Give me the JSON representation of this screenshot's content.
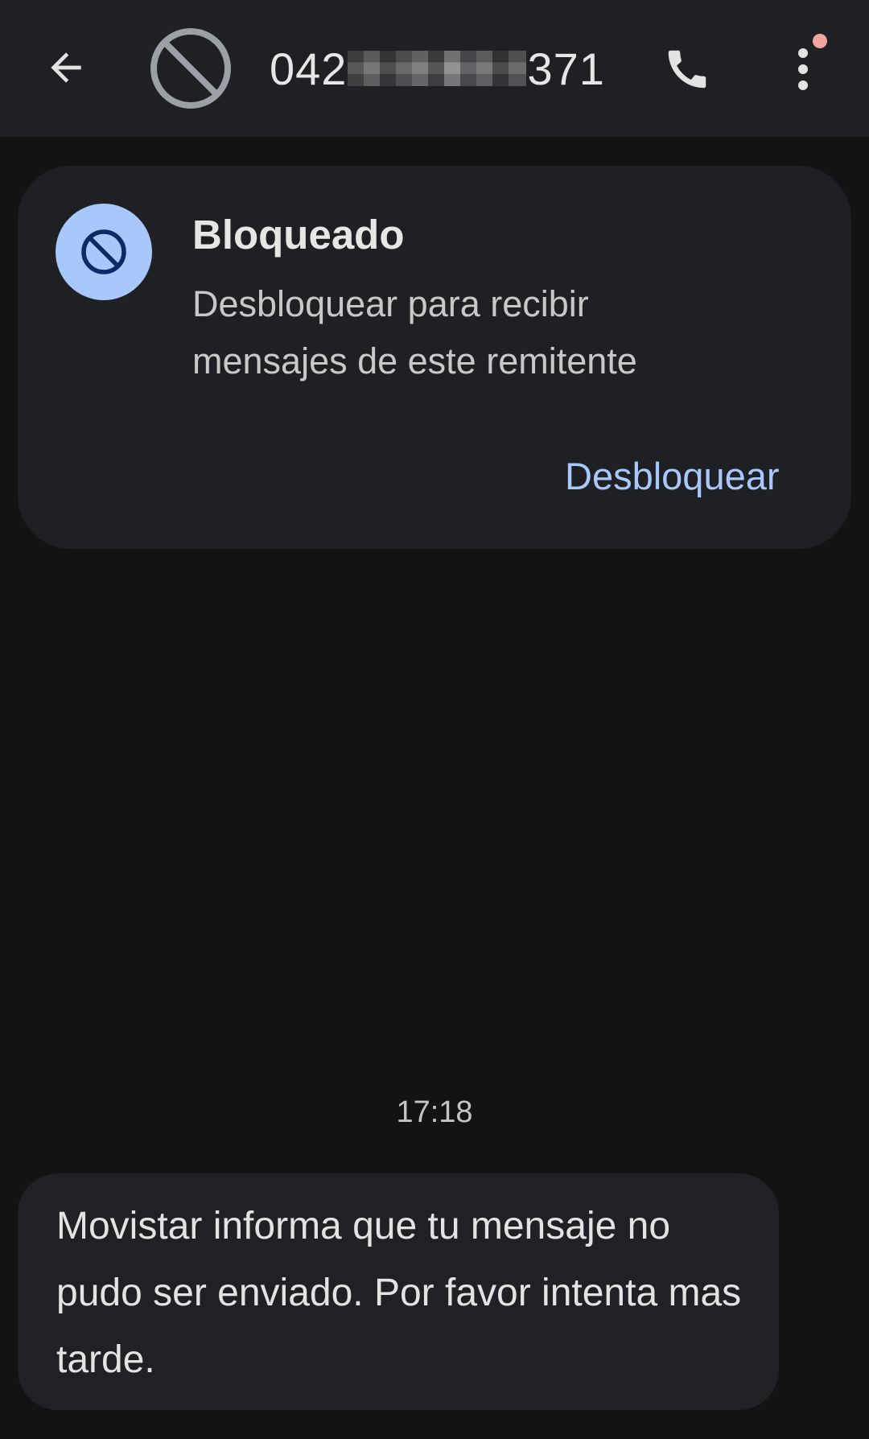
{
  "colors": {
    "app_bar_background": "#1f2023",
    "page_background": "#131314",
    "card_background": "#1f2023",
    "accent": "#a8c7fa",
    "blocked_icon_circle": "#a8c7fa",
    "blocked_icon_glyph": "#0b2a66",
    "notification_dot": "#f2a4a0",
    "icon_gray": "#e3e3e3",
    "avatar_blocked_gray": "#9aa0a6"
  },
  "header": {
    "back_icon": "arrow-back-icon",
    "avatar_icon": "block-icon",
    "title_prefix": "042",
    "title_suffix": "371",
    "call_icon": "phone-icon",
    "more_icon": "more-vert-icon"
  },
  "blocked_card": {
    "icon": "block-icon",
    "title": "Bloqueado",
    "description": "Desbloquear para recibir mensajes de este remitente",
    "unblock_label": "Desbloquear"
  },
  "conversation": {
    "timestamp": "17:18",
    "messages": [
      {
        "text": "Movistar informa que tu mensaje no pudo ser enviado. Por favor intenta mas tarde."
      }
    ]
  }
}
